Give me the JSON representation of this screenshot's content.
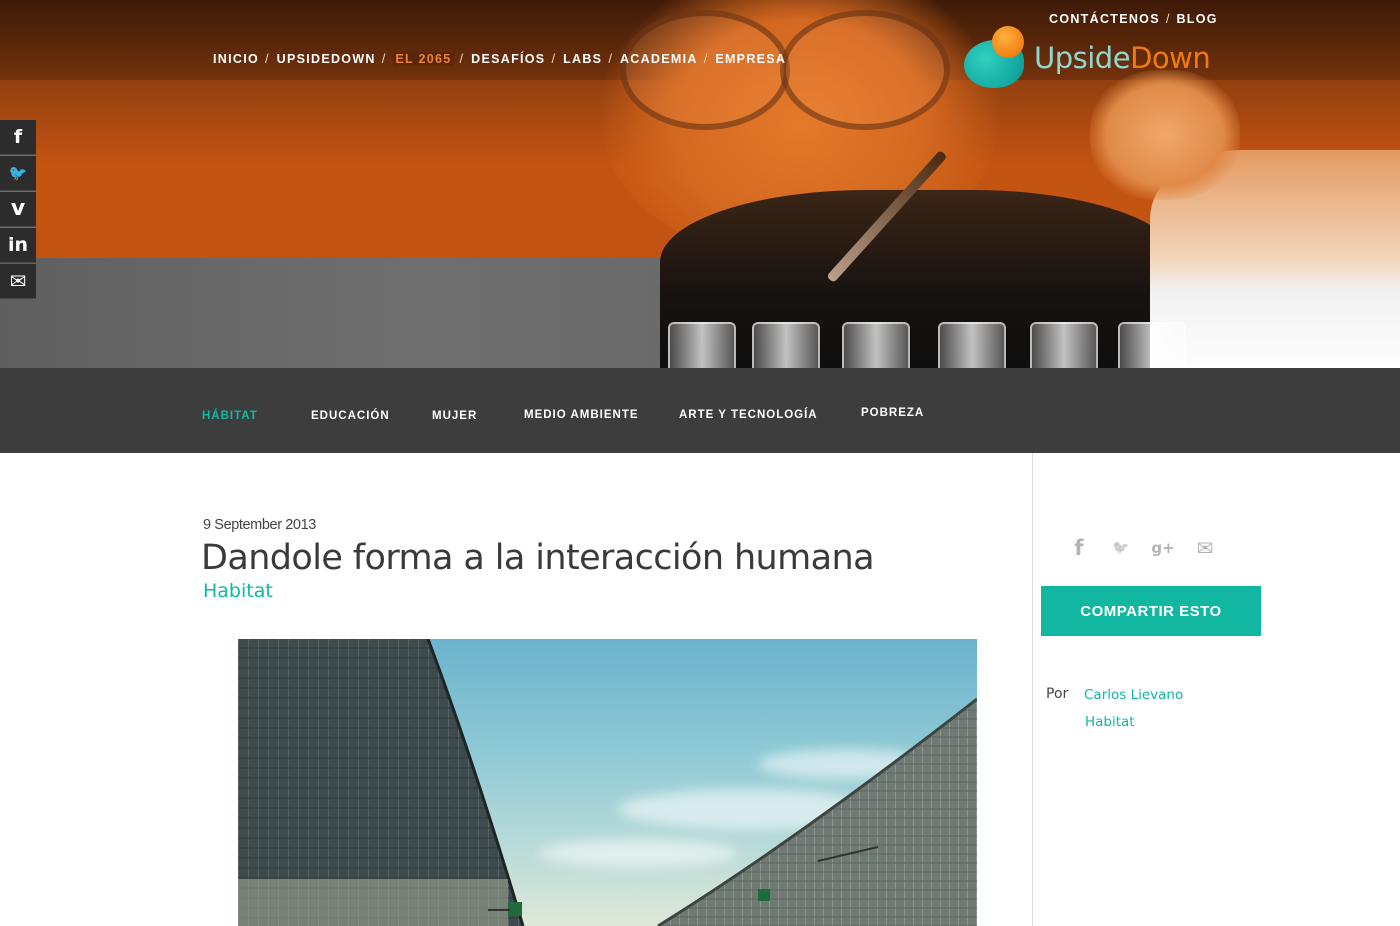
{
  "header": {
    "top_links": [
      {
        "label": "CONTÁCTENOS"
      },
      {
        "label": "BLOG"
      }
    ],
    "nav": [
      {
        "label": "INICIO"
      },
      {
        "label": "UPSIDEDOWN"
      },
      {
        "label": "EL 2065",
        "active": true
      },
      {
        "label": "DESAFÍOS"
      },
      {
        "label": "LABS"
      },
      {
        "label": "ACADEMIA"
      },
      {
        "label": "EMPRESA"
      }
    ],
    "separator": "/",
    "logo": {
      "part1": "Upside",
      "part2": "Down",
      "colors": {
        "teal": "#12a8a0",
        "orange": "#f07a10"
      }
    }
  },
  "social_rail": [
    {
      "icon": "facebook-icon",
      "glyph": "f"
    },
    {
      "icon": "twitter-icon",
      "glyph": "🐦"
    },
    {
      "icon": "vimeo-icon",
      "glyph": "v"
    },
    {
      "icon": "linkedin-icon",
      "glyph": "in"
    },
    {
      "icon": "mail-icon",
      "glyph": "✉"
    }
  ],
  "categories": [
    {
      "label": "HÁBITAT",
      "active": true
    },
    {
      "label": "EDUCACIÓN"
    },
    {
      "label": "MUJER"
    },
    {
      "label": "MEDIO AMBIENTE"
    },
    {
      "label": "ARTE Y TECNOLOGÍA"
    },
    {
      "label": "POBREZA"
    }
  ],
  "article": {
    "date": "9 September 2013",
    "title": "Dandole forma a la interacción humana",
    "category": "Habitat"
  },
  "sidebar": {
    "share_icons": [
      {
        "icon": "facebook-icon",
        "glyph": "f"
      },
      {
        "icon": "twitter-icon",
        "glyph": "🐦"
      },
      {
        "icon": "google-plus-icon",
        "glyph": "g+"
      },
      {
        "icon": "mail-icon",
        "glyph": "✉"
      }
    ],
    "share_button": "COMPARTIR ESTO",
    "author_label": "Por",
    "author": "Carlos Lievano",
    "category": "Habitat"
  },
  "colors": {
    "accent": "#12b7a2",
    "bar": "#3d3d3d",
    "orange": "#f07a10"
  }
}
